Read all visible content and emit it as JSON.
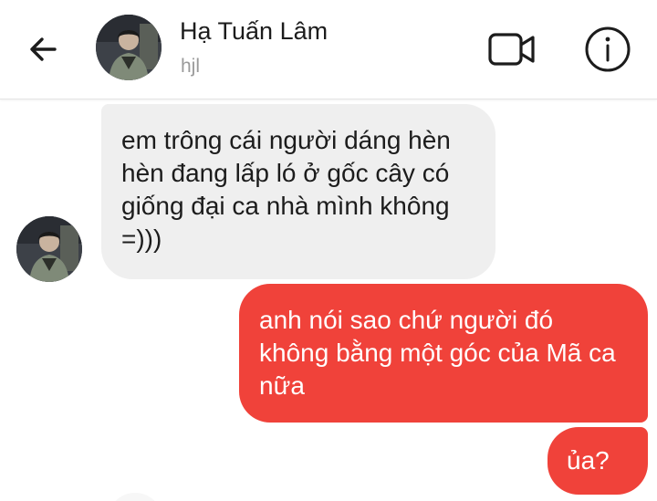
{
  "header": {
    "contact_name": "Hạ Tuấn Lâm",
    "contact_subtitle": "hjl",
    "icons": {
      "back": "back-arrow-icon",
      "video": "video-call-icon",
      "info": "info-icon"
    }
  },
  "messages": [
    {
      "direction": "incoming",
      "text": "em trông cái người dáng hèn hèn đang lấp ló ở gốc cây có giống đại ca nhà mình không =)))"
    },
    {
      "direction": "outgoing",
      "text": "anh nói sao chứ người đó không bằng một góc của Mã ca nữa"
    },
    {
      "direction": "outgoing",
      "text": "ủa?"
    }
  ],
  "colors": {
    "outgoing_bubble": "#f0423a",
    "incoming_bubble": "#efefef",
    "text_primary": "#1c1c1c",
    "text_secondary": "#9a9a9a"
  }
}
